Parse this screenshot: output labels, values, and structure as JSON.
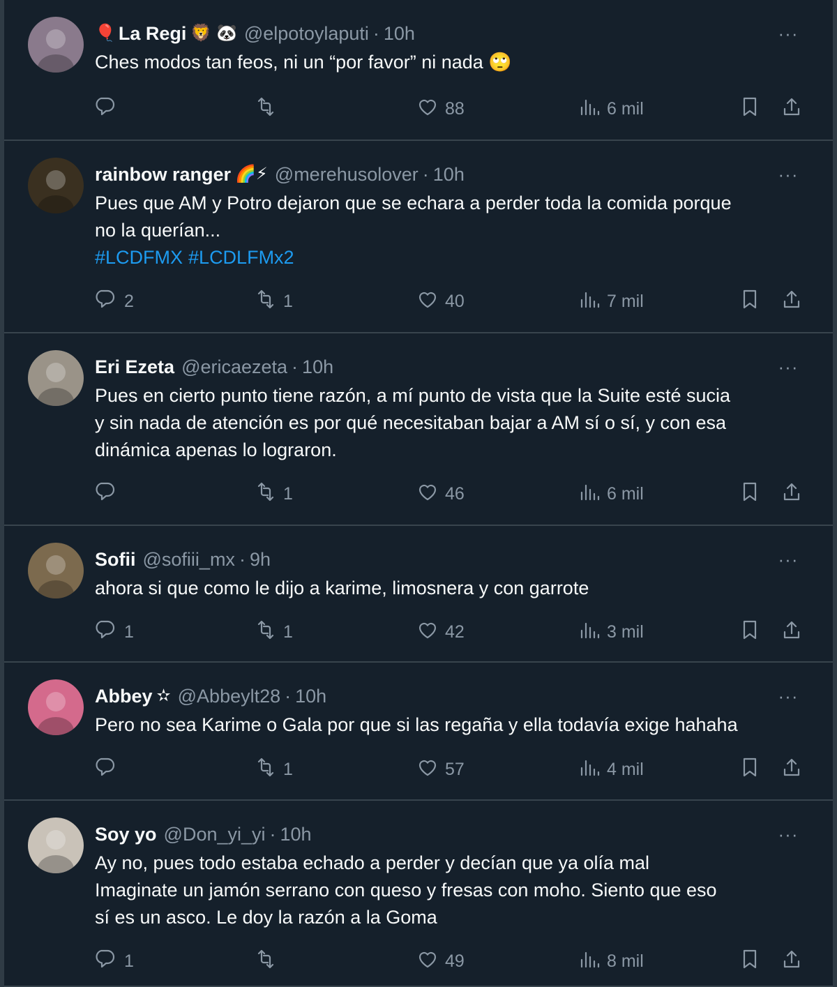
{
  "tweets": [
    {
      "name": "La Regi",
      "name_prefix": "🎈",
      "name_suffix": "🦁 🐼",
      "handle": "@elpotoylaputi",
      "time": "10h",
      "text": "Ches modos tan feos, ni un “por favor” ni nada 🙄",
      "hashtags": [],
      "replies": "",
      "retweets": "",
      "likes": "88",
      "views": "6 mil",
      "avatar_color": "#8a7a8c"
    },
    {
      "name": "rainbow ranger",
      "name_prefix": "",
      "name_suffix": "🌈⚡",
      "handle": "@merehusolover",
      "time": "10h",
      "text": "Pues que AM y Potro dejaron que se echara a perder toda la comida porque\nno la querían...",
      "hashtags": [
        "#LCDFMX",
        "#LCDLFMx2"
      ],
      "replies": "2",
      "retweets": "1",
      "likes": "40",
      "views": "7 mil",
      "avatar_color": "#3a3020"
    },
    {
      "name": "Eri Ezeta",
      "name_prefix": "",
      "name_suffix": "",
      "handle": "@ericaezeta",
      "time": "10h",
      "text": "Pues en cierto punto tiene razón, a mí punto de vista que la Suite esté sucia\ny sin nada de atención es por qué necesitaban bajar a AM sí o sí, y con esa\ndinámica apenas lo lograron.",
      "hashtags": [],
      "replies": "",
      "retweets": "1",
      "likes": "46",
      "views": "6 mil",
      "avatar_color": "#9a9388"
    },
    {
      "name": "Sofii",
      "name_prefix": "",
      "name_suffix": "",
      "handle": "@sofiii_mx",
      "time": "9h",
      "text": "ahora si que como le dijo a karime, limosnera y con garrote",
      "hashtags": [],
      "replies": "1",
      "retweets": "1",
      "likes": "42",
      "views": "3 mil",
      "avatar_color": "#7c6a4e"
    },
    {
      "name": "Abbey",
      "name_prefix": "",
      "name_suffix": "✫",
      "handle": "@Abbeylt28",
      "time": "10h",
      "text": "Pero no sea Karime o Gala por que si las regaña y ella todavía exige hahaha",
      "hashtags": [],
      "replies": "",
      "retweets": "1",
      "likes": "57",
      "views": "4 mil",
      "avatar_color": "#d46a8c"
    },
    {
      "name": "Soy yo",
      "name_prefix": "",
      "name_suffix": "",
      "handle": "@Don_yi_yi",
      "time": "10h",
      "text": "Ay no, pues todo estaba echado a perder y decían que ya olía mal\nImaginate un jamón serrano con queso y fresas con moho. Siento que eso\nsí es un asco. Le doy la razón a la Goma",
      "hashtags": [],
      "replies": "1",
      "retweets": "",
      "likes": "49",
      "views": "8 mil",
      "avatar_color": "#c9c2b8"
    }
  ],
  "more_label": "···",
  "separator": "·"
}
